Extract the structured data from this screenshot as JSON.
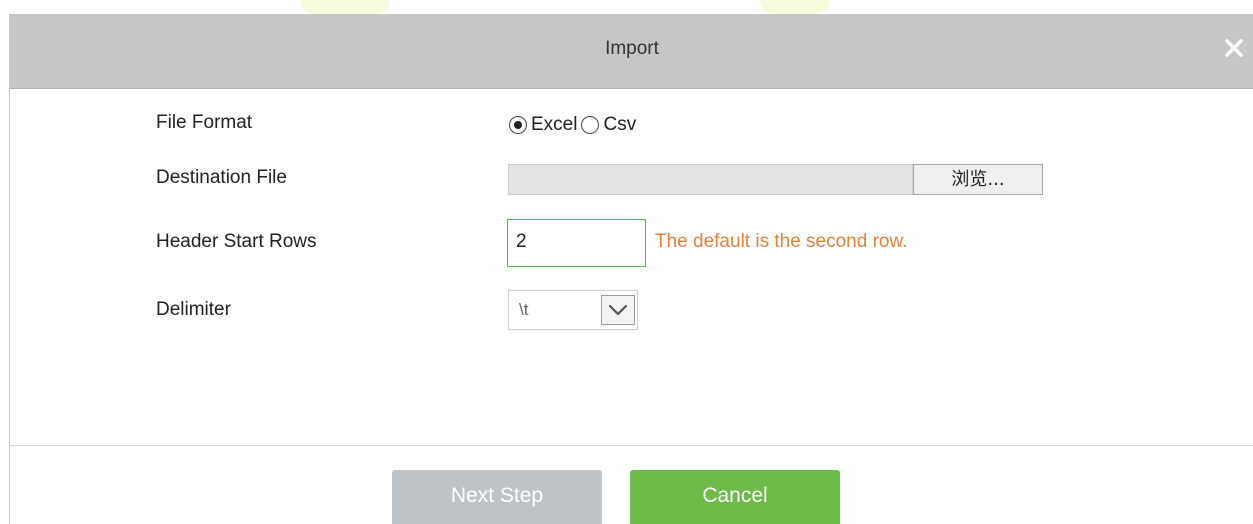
{
  "dialog": {
    "title": "Import",
    "close_icon": "close-icon"
  },
  "form": {
    "file_format": {
      "label": "File Format",
      "options": [
        {
          "label": "Excel",
          "selected": true
        },
        {
          "label": "Csv",
          "selected": false
        }
      ]
    },
    "destination_file": {
      "label": "Destination File",
      "value": "",
      "browse_label": "浏览..."
    },
    "header_start_rows": {
      "label": "Header Start Rows",
      "value": "2",
      "hint": "The default is the second row."
    },
    "delimiter": {
      "label": "Delimiter",
      "value": "\\t"
    }
  },
  "footer": {
    "next_label": "Next Step",
    "cancel_label": "Cancel"
  },
  "colors": {
    "titlebar": "#c6c6c6",
    "hint": "#e8813c",
    "focus_border": "#57b845",
    "cancel": "#6dbb49",
    "next_disabled": "#bdc3c7"
  }
}
